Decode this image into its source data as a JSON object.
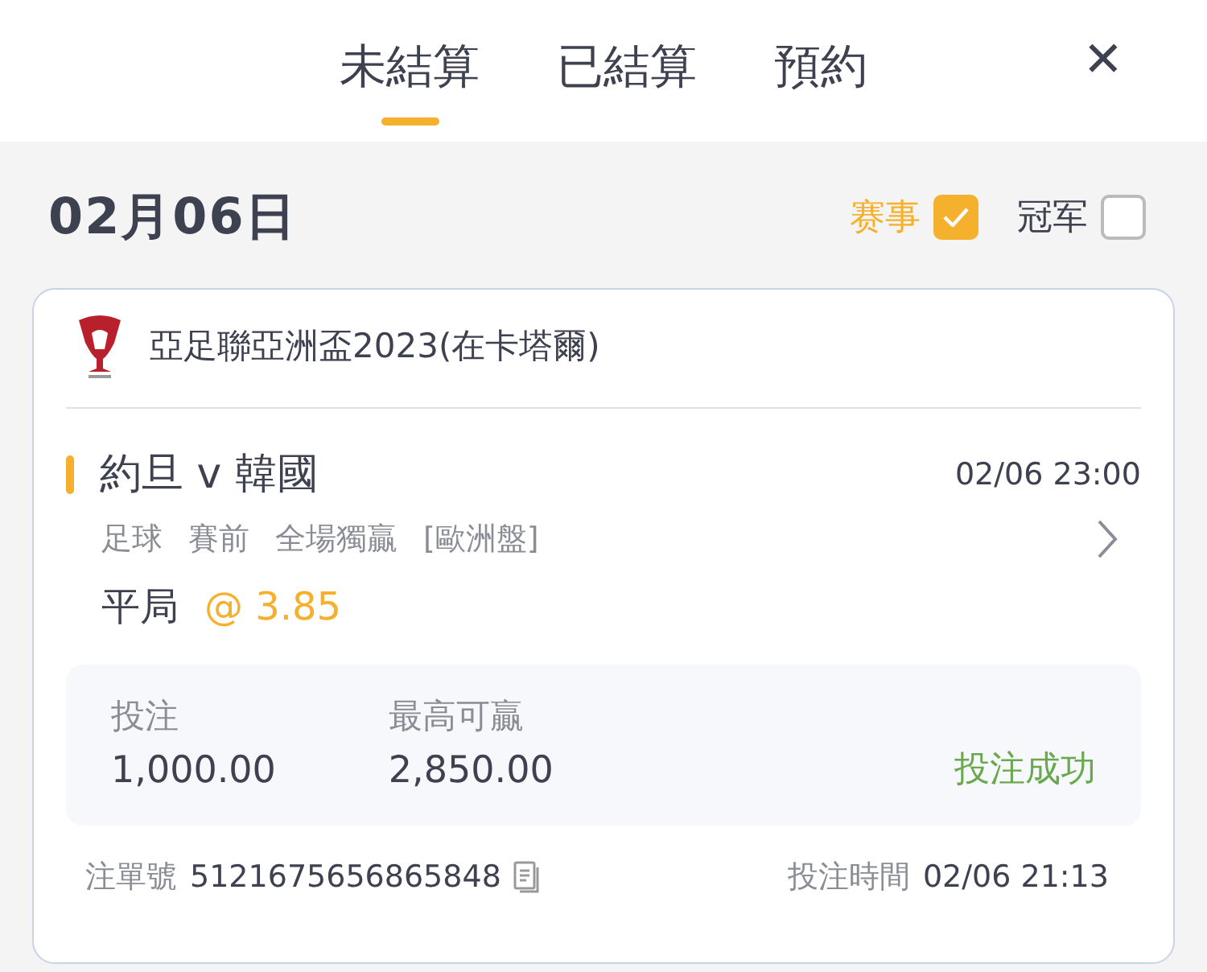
{
  "tabs": [
    {
      "label": "未結算",
      "selected": true
    },
    {
      "label": "已結算",
      "selected": false
    },
    {
      "label": "預約",
      "selected": false
    }
  ],
  "close": "✕",
  "date": "02月06日",
  "filters": [
    {
      "label": "赛事",
      "checked": true
    },
    {
      "label": "冠军",
      "checked": false
    }
  ],
  "bet": {
    "league": "亞足聯亞洲盃2023(在卡塔爾)",
    "match": "約旦 v 韓國",
    "kickoff": "02/06 23:00",
    "tags": [
      "足球",
      "賽前",
      "全場獨贏",
      "[歐洲盤]"
    ],
    "pick": "平局",
    "odds": "@ 3.85",
    "stake_label": "投注",
    "stake": "1,000.00",
    "max_win_label": "最高可贏",
    "max_win": "2,850.00",
    "status": "投注成功",
    "ticket_label": "注單號",
    "ticket": "5121675656865848",
    "time_label": "投注時間",
    "time": "02/06 21:13"
  }
}
